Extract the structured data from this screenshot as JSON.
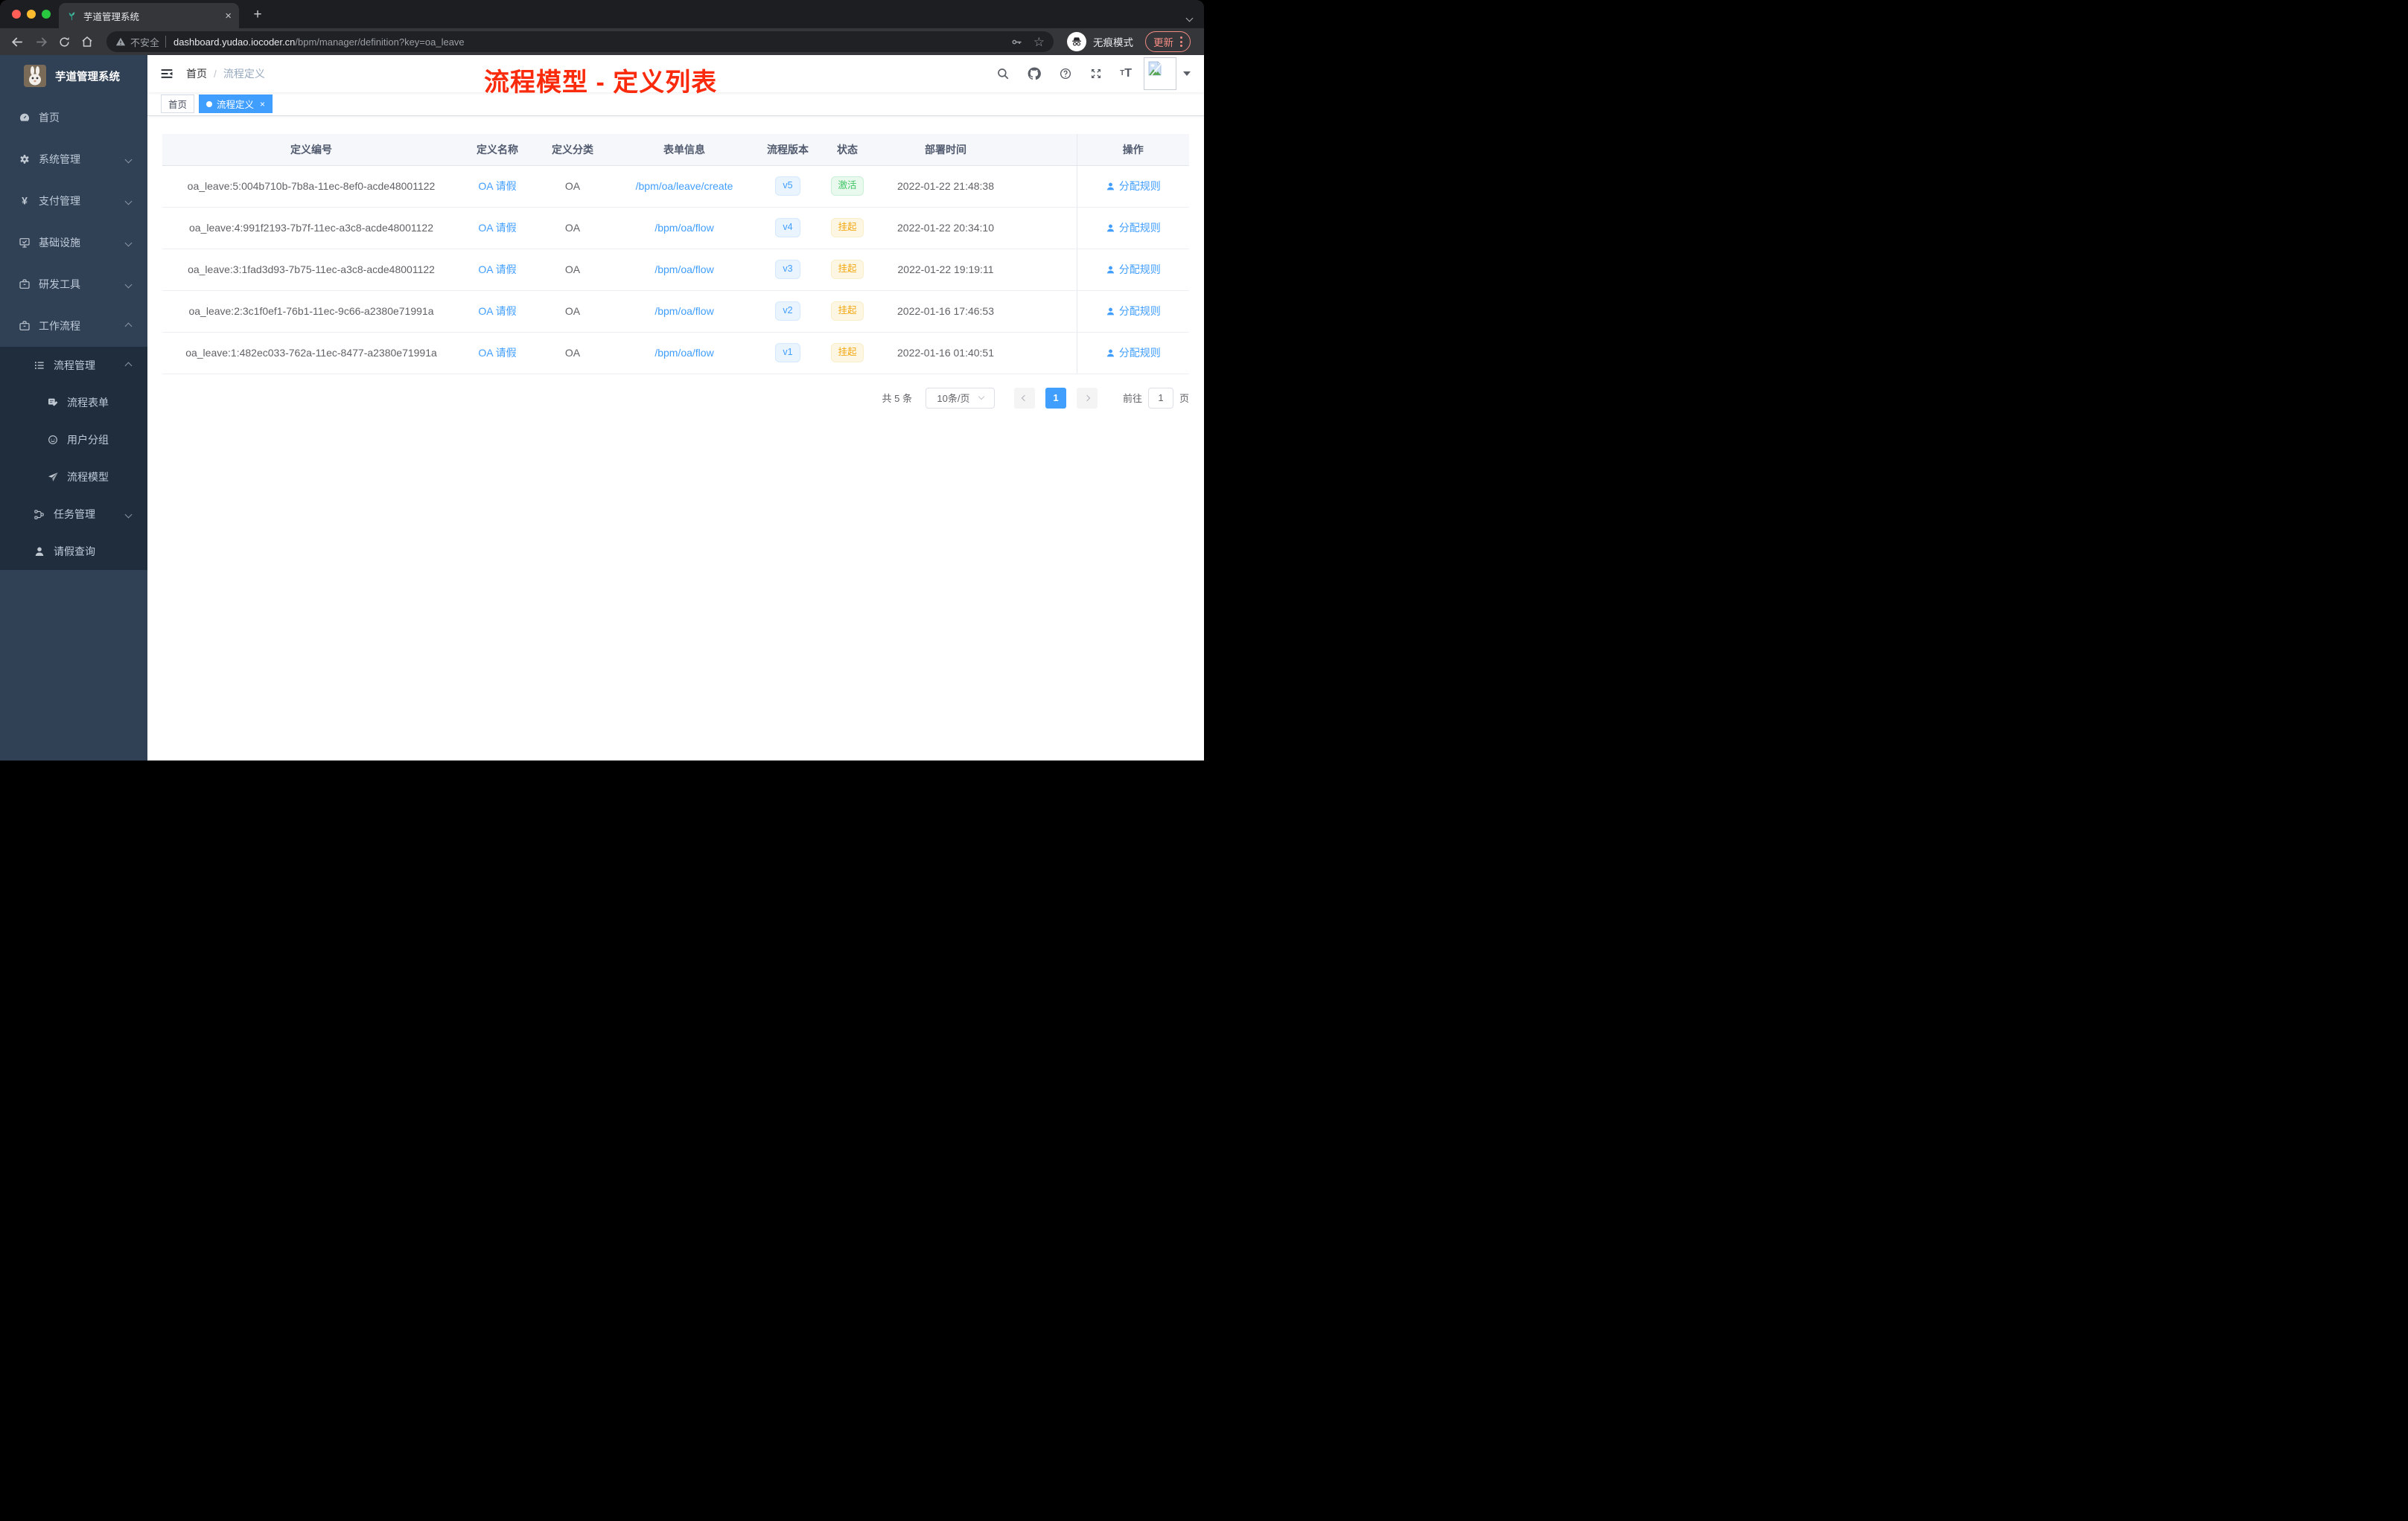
{
  "colors": {
    "accent": "#409eff",
    "annotation_red": "#fa2b0c",
    "status_active_green": "#41c565",
    "status_suspend_orange": "#f2a712",
    "sidebar_bg": "#304156",
    "submenu_bg": "#1f2d3d",
    "update_coral": "#f28b82"
  },
  "browser": {
    "tab_title": "芋道管理系统",
    "security_label": "不安全",
    "url_host": "dashboard.yudao.iocoder.cn",
    "url_path": "/bpm/manager/definition?key=oa_leave",
    "incognito_label": "无痕模式",
    "update_label": "更新"
  },
  "sidebar": {
    "title": "芋道管理系统",
    "menu": [
      {
        "label": "首页",
        "icon": "dashboard",
        "level": 1,
        "chevron": null,
        "dark": false
      },
      {
        "label": "系统管理",
        "icon": "gear",
        "level": 1,
        "chevron": "down",
        "dark": false
      },
      {
        "label": "支付管理",
        "icon": "yen",
        "level": 1,
        "chevron": "down",
        "dark": false
      },
      {
        "label": "基础设施",
        "icon": "monitor",
        "level": 1,
        "chevron": "down",
        "dark": false
      },
      {
        "label": "研发工具",
        "icon": "toolbox",
        "level": 1,
        "chevron": "down",
        "dark": false
      },
      {
        "label": "工作流程",
        "icon": "toolbox",
        "level": 1,
        "chevron": "up",
        "dark": false
      },
      {
        "label": "流程管理",
        "icon": "tree-list",
        "level": 2,
        "chevron": "up",
        "dark": true
      },
      {
        "label": "流程表单",
        "icon": "form-edit",
        "level": 3,
        "chevron": null,
        "dark": true
      },
      {
        "label": "用户分组",
        "icon": "people",
        "level": 3,
        "chevron": null,
        "dark": true
      },
      {
        "label": "流程模型",
        "icon": "paper-plane",
        "level": 3,
        "chevron": null,
        "dark": true
      },
      {
        "label": "任务管理",
        "icon": "nodes",
        "level": 2,
        "chevron": "down",
        "dark": true
      },
      {
        "label": "请假查询",
        "icon": "user",
        "level": 2,
        "chevron": null,
        "dark": true
      }
    ]
  },
  "navbar": {
    "breadcrumb": {
      "home": "首页",
      "separator": "/",
      "current": "流程定义"
    }
  },
  "annotation": {
    "text": "流程模型 - 定义列表"
  },
  "tags": {
    "home_label": "首页",
    "active_label": "流程定义"
  },
  "table": {
    "headers": [
      "定义编号",
      "定义名称",
      "定义分类",
      "表单信息",
      "流程版本",
      "状态",
      "部署时间",
      "操作"
    ],
    "action_label": "分配规则",
    "rows": [
      {
        "id": "oa_leave:5:004b710b-7b8a-11ec-8ef0-acde48001122",
        "name": "OA 请假",
        "category": "OA",
        "form": "/bpm/oa/leave/create",
        "version": "v5",
        "status": "激活",
        "status_type": "success",
        "deployed_at": "2022-01-22 21:48:38"
      },
      {
        "id": "oa_leave:4:991f2193-7b7f-11ec-a3c8-acde48001122",
        "name": "OA 请假",
        "category": "OA",
        "form": "/bpm/oa/flow",
        "version": "v4",
        "status": "挂起",
        "status_type": "warning",
        "deployed_at": "2022-01-22 20:34:10"
      },
      {
        "id": "oa_leave:3:1fad3d93-7b75-11ec-a3c8-acde48001122",
        "name": "OA 请假",
        "category": "OA",
        "form": "/bpm/oa/flow",
        "version": "v3",
        "status": "挂起",
        "status_type": "warning",
        "deployed_at": "2022-01-22 19:19:11"
      },
      {
        "id": "oa_leave:2:3c1f0ef1-76b1-11ec-9c66-a2380e71991a",
        "name": "OA 请假",
        "category": "OA",
        "form": "/bpm/oa/flow",
        "version": "v2",
        "status": "挂起",
        "status_type": "warning",
        "deployed_at": "2022-01-16 17:46:53"
      },
      {
        "id": "oa_leave:1:482ec033-762a-11ec-8477-a2380e71991a",
        "name": "OA 请假",
        "category": "OA",
        "form": "/bpm/oa/flow",
        "version": "v1",
        "status": "挂起",
        "status_type": "warning",
        "deployed_at": "2022-01-16 01:40:51"
      }
    ]
  },
  "pagination": {
    "total_label": "共 5 条",
    "page_size": "10条/页",
    "current_page": "1",
    "goto_label": "前往",
    "goto_value": "1",
    "page_unit": "页"
  }
}
